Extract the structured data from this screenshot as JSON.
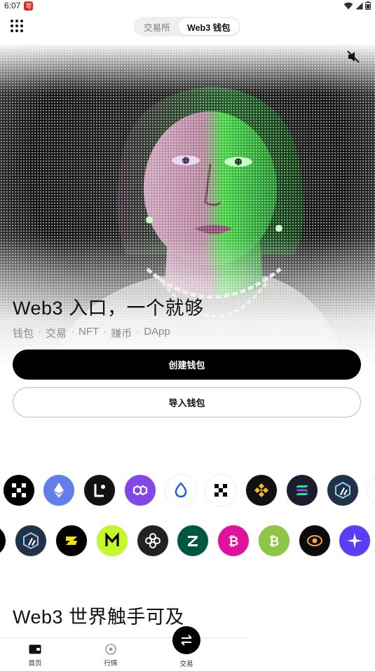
{
  "status_bar": {
    "time": "6:07",
    "notif_glyph": "咢"
  },
  "top_bar": {
    "tabs": [
      {
        "label": "交易所",
        "active": false
      },
      {
        "label": "Web3 钱包",
        "active": true
      }
    ]
  },
  "hero": {
    "title": "Web3 入口，一个就够",
    "tags": [
      "钱包",
      "交易",
      "NFT",
      "赚币",
      "DApp"
    ],
    "separator": "·",
    "create_label": "创建钱包",
    "import_label": "导入钱包"
  },
  "tokens_row1": [
    {
      "name": "okx",
      "bg": "#000000"
    },
    {
      "name": "ethereum",
      "bg": "#627eea"
    },
    {
      "name": "linea",
      "bg": "#121212"
    },
    {
      "name": "polygon",
      "bg": "#8247e5"
    },
    {
      "name": "sui",
      "bg": "#ffffff"
    },
    {
      "name": "okx-chain",
      "bg": "#ffffff"
    },
    {
      "name": "bnb",
      "bg": "#111111"
    },
    {
      "name": "solana",
      "bg": "#1c1c2e"
    },
    {
      "name": "arbitrum",
      "bg": "#213147"
    },
    {
      "name": "aptos",
      "bg": "#ffffff"
    }
  ],
  "tokens_row2": [
    {
      "name": "dark-partial",
      "bg": "#000000"
    },
    {
      "name": "arbitrum",
      "bg": "#213147"
    },
    {
      "name": "zb",
      "bg": "#000000"
    },
    {
      "name": "mantle",
      "bg": "#c4f82a"
    },
    {
      "name": "flower",
      "bg": "#222222"
    },
    {
      "name": "zeta",
      "bg": "#005741"
    },
    {
      "name": "bitcoin-pink",
      "bg": "#e0119d"
    },
    {
      "name": "bitcoin-green",
      "bg": "#8dc647"
    },
    {
      "name": "rsk",
      "bg": "#0b0b0b"
    },
    {
      "name": "star",
      "bg": "#5b3df5"
    }
  ],
  "section_title": "Web3 世界触手可及",
  "bottom_nav": {
    "home": "首页",
    "market": "行情",
    "trade": "交易"
  }
}
